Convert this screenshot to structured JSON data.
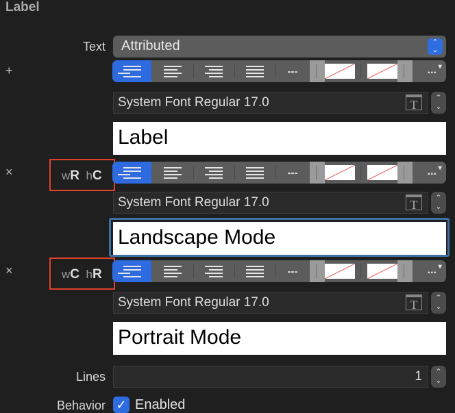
{
  "header": {
    "title": "Label"
  },
  "text_row": {
    "label": "Text",
    "value": "Attributed",
    "arrows": "⌃⌄"
  },
  "toolbar": {
    "dashes": "---",
    "more": "...",
    "more_arrow": "▾"
  },
  "variants": [
    {
      "side_icon": "+",
      "trait_w": "",
      "trait_h": "",
      "font": "System Font Regular 17.0",
      "text": "Label"
    },
    {
      "side_icon": "×",
      "trait_w": "R",
      "trait_h": "C",
      "font": "System Font Regular 17.0",
      "text": "Landscape Mode"
    },
    {
      "side_icon": "×",
      "trait_w": "C",
      "trait_h": "R",
      "font": "System Font Regular 17.0",
      "text": "Portrait Mode"
    }
  ],
  "trait_prefix": {
    "w": "w",
    "h": "h"
  },
  "font_icon": "T",
  "lines": {
    "label": "Lines",
    "value": "1"
  },
  "behavior": {
    "label": "Behavior",
    "checkbox_label": "Enabled",
    "checked": true,
    "check": "✓"
  },
  "colors": {
    "accent": "#2e6be0",
    "highlight": "#e0412a",
    "focus": "#3d6fa3"
  }
}
